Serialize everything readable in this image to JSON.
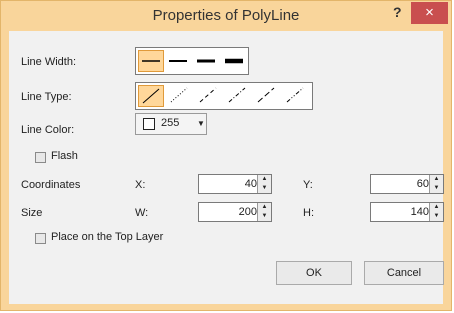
{
  "window": {
    "title": "Properties of PolyLine",
    "help_label": "?",
    "close_label": "×"
  },
  "line_width": {
    "label": "Line Width:",
    "options": [
      "thin",
      "medium",
      "thick",
      "thickest"
    ],
    "selected": 0
  },
  "line_type": {
    "label": "Line Type:",
    "options": [
      "solid",
      "dotted",
      "dashed",
      "dash-dot",
      "long-dash",
      "dash-dot-dot"
    ],
    "selected": 0
  },
  "line_color": {
    "label": "Line Color:",
    "value": "255",
    "swatch": "#ffffff"
  },
  "flash": {
    "label": "Flash",
    "checked": false
  },
  "coordinates": {
    "label": "Coordinates",
    "x_label": "X:",
    "x_value": "40",
    "y_label": "Y:",
    "y_value": "60"
  },
  "size": {
    "label": "Size",
    "w_label": "W:",
    "w_value": "200",
    "h_label": "H:",
    "h_value": "140"
  },
  "top_layer": {
    "label": "Place on the Top Layer",
    "checked": false
  },
  "buttons": {
    "ok": "OK",
    "cancel": "Cancel"
  },
  "colors": {
    "title_bar": "#f9d59b",
    "close": "#c94f4f",
    "selected": "#ffd79a"
  }
}
